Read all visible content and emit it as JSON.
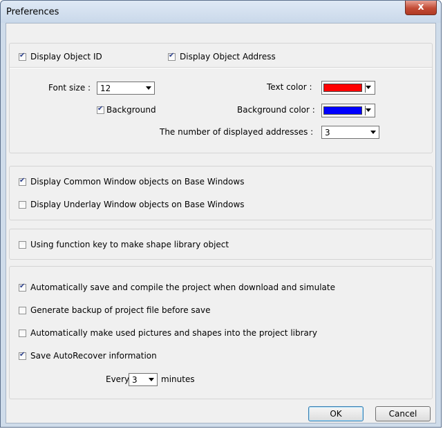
{
  "window": {
    "title": "Preferences",
    "close_glyph": "x"
  },
  "object_display": {
    "display_object_id": {
      "label": "Display Object ID",
      "checked": true
    },
    "display_object_address": {
      "label": "Display Object Address",
      "checked": true
    },
    "font_size": {
      "label": "Font size :",
      "value": "12"
    },
    "text_color": {
      "label": "Text color :",
      "color": "#ff0000"
    },
    "background": {
      "label": "Background",
      "checked": true
    },
    "background_color": {
      "label": "Background color :",
      "color": "#0000ff"
    },
    "num_addresses": {
      "label": "The number of displayed addresses :",
      "value": "3"
    }
  },
  "windows": {
    "common": {
      "label": "Display Common Window objects on Base Windows",
      "checked": true
    },
    "underlay": {
      "label": "Display Underlay Window objects on Base Windows",
      "checked": false
    }
  },
  "function_key": {
    "label": "Using function key to make shape library object",
    "checked": false
  },
  "project": {
    "auto_save": {
      "label": "Automatically save and compile the project when download and simulate",
      "checked": true
    },
    "backup": {
      "label": "Generate backup of project file before save",
      "checked": false
    },
    "auto_library": {
      "label": "Automatically make used pictures and shapes into the project library",
      "checked": false
    },
    "autorecover": {
      "label": "Save AutoRecover information",
      "checked": true
    },
    "every": {
      "prefix": "Every",
      "value": "3",
      "suffix": "minutes"
    }
  },
  "buttons": {
    "ok": "OK",
    "cancel": "Cancel"
  }
}
